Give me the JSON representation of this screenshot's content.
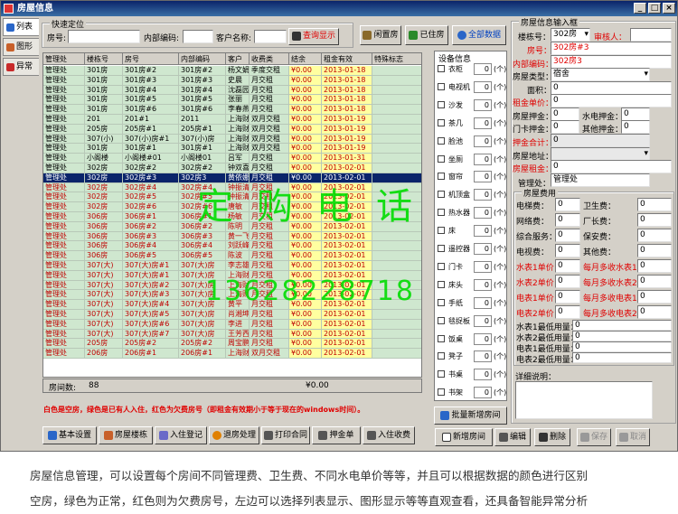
{
  "window": {
    "title": "房屋信息"
  },
  "left_tabs": [
    "列表",
    "图形",
    "异常"
  ],
  "quick": {
    "caption": "快速定位",
    "room_label": "房号:",
    "code_label": "内部编码:",
    "client_label": "客户名称:",
    "search_btn": "查询显示",
    "btn_vacant": "闲置房",
    "btn_occupied": "已住房",
    "btn_all": "全部数据"
  },
  "grid": {
    "headers": [
      "管理处",
      "楼栋号",
      "房号",
      "内部编码",
      "客户",
      "收费类",
      "结余",
      "租金有效",
      "特殊标志"
    ],
    "rows": [
      {
        "s": "g",
        "c": [
          "管理处",
          "301房",
          "301房#2",
          "301房#2",
          "杨文娟",
          "季度交租",
          "¥0.00",
          "2013-01-18",
          ""
        ]
      },
      {
        "s": "g",
        "c": [
          "管理处",
          "301房",
          "301房#3",
          "301房#3",
          "史晨",
          "月交租",
          "¥0.00",
          "2013-01-18",
          ""
        ]
      },
      {
        "s": "g",
        "c": [
          "管理处",
          "301房",
          "301房#4",
          "301房#4",
          "沈磊园",
          "月交租",
          "¥0.00",
          "2013-01-18",
          ""
        ]
      },
      {
        "s": "g",
        "c": [
          "管理处",
          "301房",
          "301房#5",
          "301房#5",
          "张丽",
          "月交租",
          "¥0.00",
          "2013-01-18",
          ""
        ]
      },
      {
        "s": "g",
        "c": [
          "管理处",
          "301房",
          "301房#6",
          "301房#6",
          "李春燕",
          "月交租",
          "¥0.00",
          "2013-01-18",
          ""
        ]
      },
      {
        "s": "g",
        "c": [
          "管理处",
          "201",
          "201#1",
          "2011",
          "上海财",
          "双月交租",
          "¥0.00",
          "2013-01-19",
          ""
        ]
      },
      {
        "s": "g",
        "c": [
          "管理处",
          "205房",
          "205房#1",
          "205房#1",
          "上海财",
          "双月交租",
          "¥0.00",
          "2013-01-19",
          ""
        ]
      },
      {
        "s": "g",
        "c": [
          "管理处",
          "307(小)",
          "307(小)房#1",
          "307(小)房",
          "上海财",
          "双月交租",
          "¥0.00",
          "2013-01-19",
          ""
        ]
      },
      {
        "s": "g",
        "c": [
          "管理处",
          "301房",
          "301房#1",
          "301房#1",
          "上海财",
          "双月交租",
          "¥0.00",
          "2013-01-19",
          ""
        ]
      },
      {
        "s": "g",
        "c": [
          "管理处",
          "小阁楼",
          "小阁楼#01",
          "小阁楼01",
          "吕军",
          "月交租",
          "¥0.00",
          "2013-01-31",
          ""
        ]
      },
      {
        "s": "g",
        "c": [
          "管理处",
          "302房",
          "302房#2",
          "302房#2",
          "钟双喜",
          "月交租",
          "¥0.00",
          "2013-02-01",
          ""
        ]
      },
      {
        "s": "sel",
        "c": [
          "管理处",
          "302房",
          "302房#3",
          "302房3",
          "黄依娜",
          "月交租",
          "¥0.00",
          "2013-02-01",
          ""
        ]
      },
      {
        "s": "r",
        "c": [
          "管理处",
          "302房",
          "302房#4",
          "302房#4",
          "钟振清",
          "月交租",
          "¥0.00",
          "2013-02-01",
          ""
        ]
      },
      {
        "s": "r",
        "c": [
          "管理处",
          "302房",
          "302房#5",
          "302房#5",
          "钟振清",
          "月交租",
          "¥0.00",
          "2013-02-01",
          ""
        ]
      },
      {
        "s": "r",
        "c": [
          "管理处",
          "302房",
          "302房#6",
          "302房#6",
          "唐敏",
          "月交租",
          "¥0.00",
          "2013-02-01",
          ""
        ]
      },
      {
        "s": "r",
        "c": [
          "管理处",
          "306房",
          "306房#1",
          "306房#1",
          "杨敏",
          "月交租",
          "¥0.00",
          "2013-02-01",
          ""
        ]
      },
      {
        "s": "r",
        "c": [
          "管理处",
          "306房",
          "306房#2",
          "306房#2",
          "陈明",
          "月交租",
          "¥0.00",
          "2013-02-01",
          ""
        ]
      },
      {
        "s": "r",
        "c": [
          "管理处",
          "306房",
          "306房#3",
          "306房#3",
          "黄一飞",
          "月交租",
          "¥0.00",
          "2013-02-01",
          ""
        ]
      },
      {
        "s": "r",
        "c": [
          "管理处",
          "306房",
          "306房#4",
          "306房#4",
          "刘跃峰",
          "月交租",
          "¥0.00",
          "2013-02-01",
          ""
        ]
      },
      {
        "s": "r",
        "c": [
          "管理处",
          "306房",
          "306房#5",
          "306房#5",
          "陈波",
          "月交租",
          "¥0.00",
          "2013-02-01",
          ""
        ]
      },
      {
        "s": "r",
        "c": [
          "管理处",
          "307(大)",
          "307(大)房#1",
          "307(大)房",
          "李志雄",
          "月交租",
          "¥0.00",
          "2013-02-01",
          ""
        ]
      },
      {
        "s": "r",
        "c": [
          "管理处",
          "307(大)",
          "307(大)房#1",
          "307(大)房",
          "上海财",
          "月交租",
          "¥0.00",
          "2013-02-01",
          ""
        ]
      },
      {
        "s": "r",
        "c": [
          "管理处",
          "307(大)",
          "307(大)房#2",
          "307(大)房",
          "上海财",
          "月交租",
          "¥0.00",
          "2013-02-01",
          ""
        ]
      },
      {
        "s": "r",
        "c": [
          "管理处",
          "307(大)",
          "307(大)房#3",
          "307(大)房",
          "上海财",
          "月交租",
          "¥0.00",
          "2013-02-01",
          ""
        ]
      },
      {
        "s": "r",
        "c": [
          "管理处",
          "307(大)",
          "307(大)房#4",
          "307(大)房",
          "黄平",
          "月交租",
          "¥0.00",
          "2013-02-01",
          ""
        ]
      },
      {
        "s": "r",
        "c": [
          "管理处",
          "307(大)",
          "307(大)房#5",
          "307(大)房",
          "肖湘坤",
          "月交租",
          "¥0.00",
          "2013-02-01",
          ""
        ]
      },
      {
        "s": "r",
        "c": [
          "管理处",
          "307(大)",
          "307(大)房#6",
          "307(大)房",
          "李进",
          "月交租",
          "¥0.00",
          "2013-02-01",
          ""
        ]
      },
      {
        "s": "r",
        "c": [
          "管理处",
          "307(大)",
          "307(大)房#7",
          "307(大)房",
          "王芳西",
          "月交租",
          "¥0.00",
          "2013-02-01",
          ""
        ]
      },
      {
        "s": "r",
        "c": [
          "管理处",
          "205房",
          "205房#2",
          "205房#2",
          "周宝鹏",
          "月交租",
          "¥0.00",
          "2013-02-01",
          ""
        ]
      },
      {
        "s": "r",
        "c": [
          "管理处",
          "206房",
          "206房#1",
          "206房#1",
          "上海财",
          "双月交租",
          "¥0.00",
          "2013-02-01",
          ""
        ]
      }
    ],
    "room_count_label": "房间数:",
    "room_count": "88",
    "total": "¥0.00"
  },
  "note": "白色是空房，绿色是已有人入住，红色为欠费房号（即租金有效期小于等于现在的windows时间）。",
  "bottom_buttons": [
    "基本设置",
    "房屋楼栋",
    "入住登记",
    "退房处理",
    "打印合同",
    "押金单",
    "入住收费"
  ],
  "equipment": {
    "caption": "设备信息",
    "items": [
      "衣柜",
      "电视机",
      "沙发",
      "茶几",
      "脸池",
      "坐厕",
      "窗帘",
      "机顶盒",
      "热水器",
      "床",
      "遥控器",
      "门卡",
      "床头",
      "手纸",
      "毯捉板",
      "饭桌",
      "凳子",
      "书桌",
      "书架"
    ],
    "qty": "0",
    "unit": "(个)",
    "batch_btn": "批量新增房间"
  },
  "form": {
    "caption": "房屋信息输入框",
    "building_label": "楼栋号：",
    "building_value": "302房",
    "approver_label": "审核人：",
    "room_label": "房号：",
    "room_value": "302房#3",
    "code_label": "内部编码：",
    "code_value": "302房3",
    "type_label": "房屋类型：",
    "type_value": "宿舍",
    "area_label": "面积：",
    "area_value": "0",
    "rent_price_label": "租金单价：",
    "rent_price_value": "0",
    "deposit_label": "房屋押金：",
    "deposit_value": "0",
    "utility_deposit_label": "水电押金：",
    "utility_deposit_value": "0",
    "card_deposit_label": "门卡押金：",
    "card_deposit_value": "0",
    "other_deposit_label": "其他押金：",
    "other_deposit_value": "0",
    "deposit_total_label": "押金合计：",
    "deposit_total_value": "0",
    "address_label": "房屋地址：",
    "rent_label": "房屋租金：",
    "rent_value": "0",
    "mgmt_label": "管理处：",
    "mgmt_value": "管理处",
    "fee_caption": "房屋费用",
    "fees": [
      {
        "l": "电梯费：",
        "v": "0",
        "l2": "卫生费：",
        "v2": "0",
        "red": false
      },
      {
        "l": "网络费：",
        "v": "0",
        "l2": "厂长费：",
        "v2": "0",
        "red": false
      },
      {
        "l": "综合服务：",
        "v": "0",
        "l2": "保安费：",
        "v2": "0",
        "red": false
      },
      {
        "l": "电视费：",
        "v": "0",
        "l2": "其他费：",
        "v2": "0",
        "red": false
      },
      {
        "l": "水表1单价：",
        "v": "0",
        "l2": "每月多收水表1：",
        "v2": "0",
        "red": true
      },
      {
        "l": "水表2单价：",
        "v": "0",
        "l2": "每月多收水表2：",
        "v2": "0",
        "red": true
      },
      {
        "l": "电表1单价：",
        "v": "0",
        "l2": "每月多收电表1：",
        "v2": "0",
        "red": true
      },
      {
        "l": "电表2单价：",
        "v": "0",
        "l2": "每月多收电表2：",
        "v2": "0",
        "red": true
      }
    ],
    "usage": [
      {
        "l": "水表1最低用量：",
        "v": "0"
      },
      {
        "l": "水表2最低用量：",
        "v": "0"
      },
      {
        "l": "电表1最低用量：",
        "v": "0"
      },
      {
        "l": "电表2最低用量：",
        "v": "0"
      }
    ],
    "detail_label": "详细说明：",
    "btn_new": "新增房间",
    "btn_edit": "编辑",
    "btn_delete": "删除",
    "btn_save": "保存",
    "btn_cancel": "取消"
  },
  "watermark": {
    "line1": "定购电话",
    "line2": "13628228718"
  },
  "description": {
    "line1": "房屋信息管理，可以设置每个房间不同管理费、卫生费、不同水电单价等等，并且可以根据数据的颜色进行区别",
    "line2": "空房，绿色为正常，红色则为欠费房号，左边可以选择列表显示、图形显示等等直观查看，还具备智能异常分析"
  }
}
